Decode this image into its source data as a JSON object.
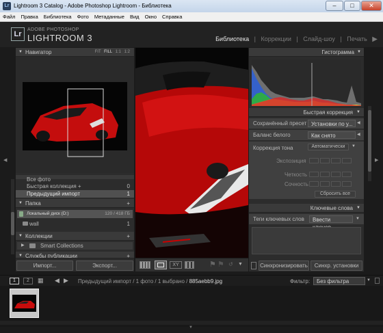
{
  "window": {
    "title": "Lightroom 3 Catalog - Adobe Photoshop Lightroom - Библиотека",
    "minimize": "–",
    "maximize": "□",
    "close": "✕"
  },
  "menu": [
    "Файл",
    "Правка",
    "Библиотека",
    "Фото",
    "Метаданные",
    "Вид",
    "Окно",
    "Справка"
  ],
  "identity": {
    "small": "ADOBE PHOTOSHOP",
    "big": "LIGHTROOM 3",
    "mark": "Lr"
  },
  "modules": [
    "Библиотека",
    "Коррекции",
    "Слайд-шоу",
    "Печать"
  ],
  "navigator": {
    "title": "Навигатор",
    "zoom": [
      "FIT",
      "FILL",
      "1:1",
      "1:2"
    ]
  },
  "catalog": {
    "items": [
      {
        "label": "Все фото",
        "count": ""
      },
      {
        "label": "Быстрая коллекция +",
        "count": "0"
      },
      {
        "label": "Предыдущий импорт",
        "count": "1"
      }
    ]
  },
  "folders": {
    "title": "Папка",
    "plus": "+",
    "disk": "Локальный диск (D:)",
    "disk_info": "120 / 418 ГБ",
    "folder": "wall",
    "folder_count": "1"
  },
  "collections": {
    "title": "Коллекции",
    "plus": "+",
    "smart": "Smart Collections"
  },
  "publish": {
    "title": "Службы публикации",
    "plus": "+"
  },
  "left_buttons": {
    "import": "Импорт...",
    "export": "Экспорт..."
  },
  "histogram": {
    "title": "Гистограмма",
    "colors": {
      "red": "#d42b2b",
      "green": "#2fb23a",
      "blue": "#2f5fd4",
      "yellow": "#e6d23a"
    }
  },
  "quick_develop": {
    "title": "Быстрая коррекция",
    "preset_label": "Сохранённый пресет",
    "preset_value": "Установки по у...",
    "wb_label": "Баланс белого",
    "wb_value": "Как снято",
    "tone_label": "Коррекция тона",
    "auto": "Автоматически",
    "exposure": "Экспозиция",
    "clarity": "Четкость",
    "vibrance": "Сочность",
    "reset": "Сбросить все"
  },
  "keywords": {
    "title": "Ключевые слова",
    "tags_label": "Теги ключевых слов",
    "tags_value": "Ввести ключев..."
  },
  "right_buttons": {
    "sync": "Синхронизировать",
    "sync_settings": "Синхр. установки"
  },
  "filmstrip_bar": {
    "page1": "1",
    "page2": "2",
    "path": "Предыдущий импорт / 1 фото / 1 выбрано /",
    "file": "885aebb9.jpg",
    "filter_label": "Фильтр:",
    "filter_value": "Без фильтра"
  },
  "accent": "#cf0000"
}
